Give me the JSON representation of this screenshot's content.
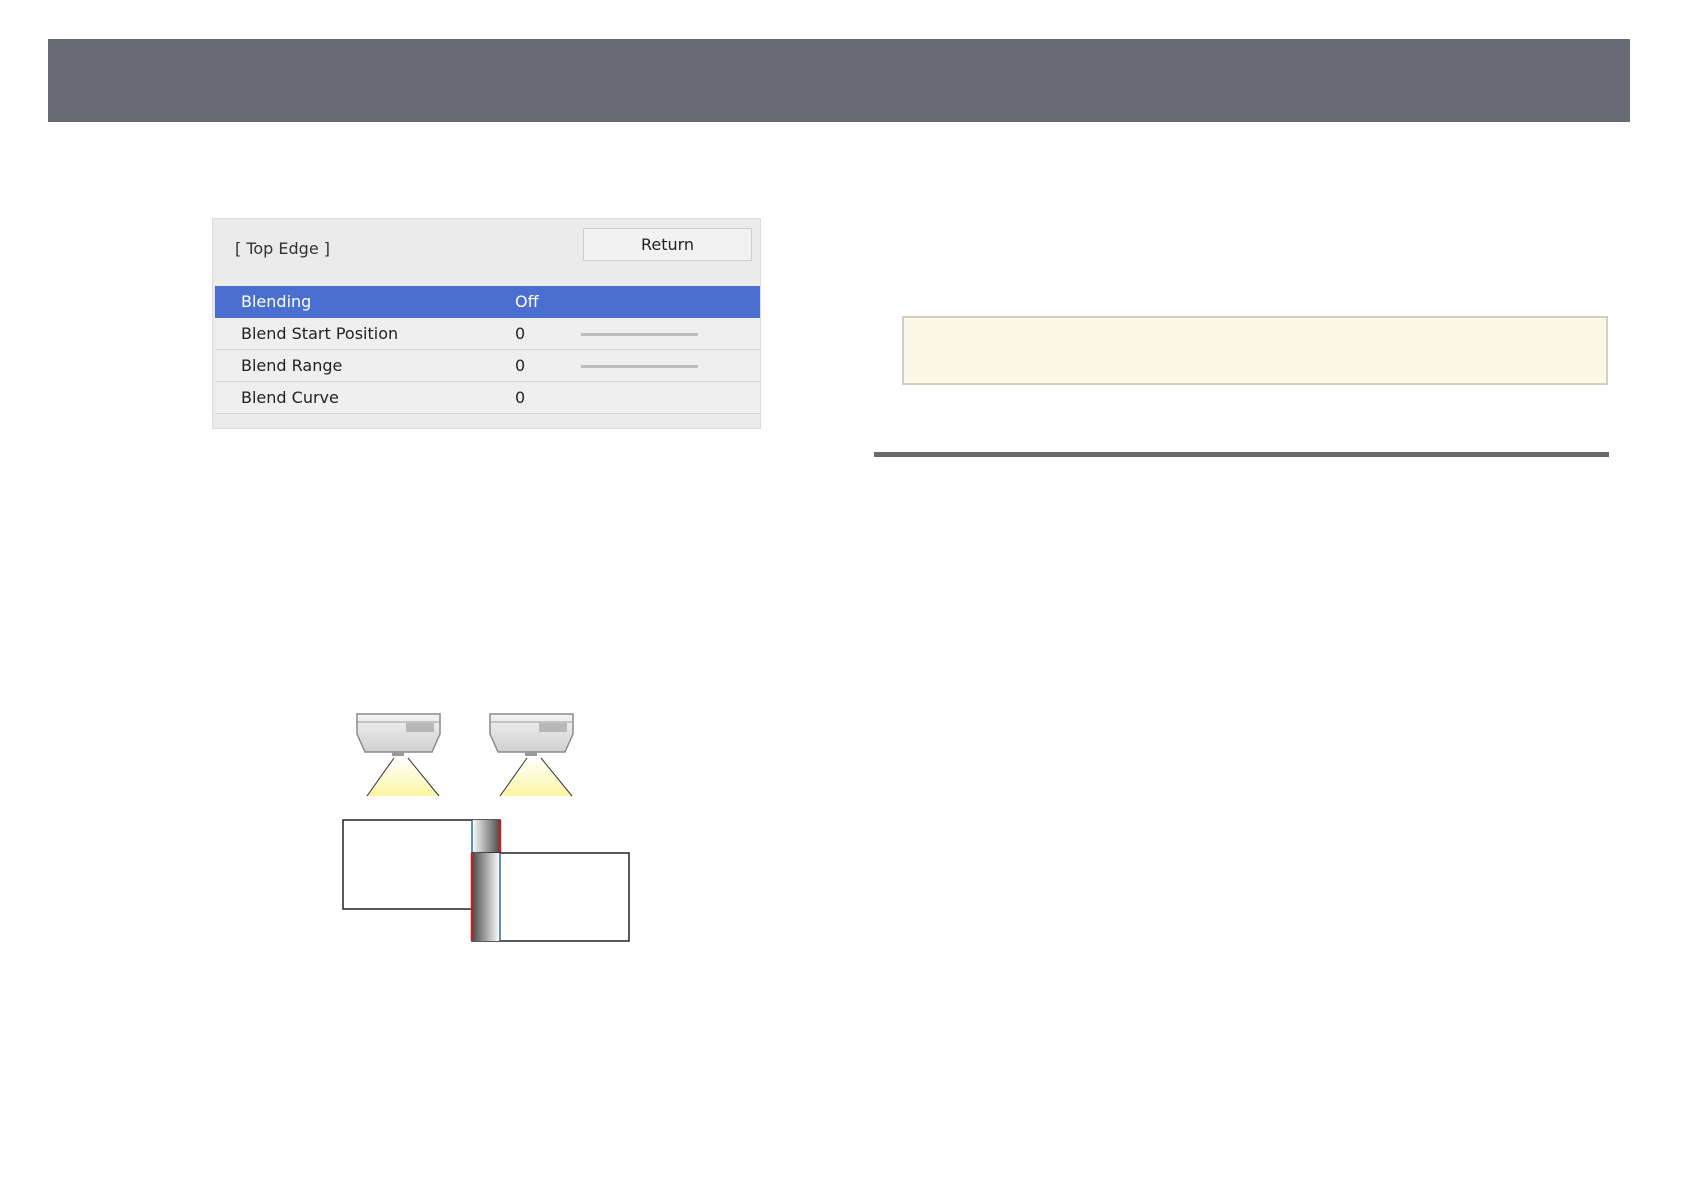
{
  "menu": {
    "title": "[ Top Edge ]",
    "return_label": "Return",
    "rows": [
      {
        "label": "Blending",
        "value": "Off",
        "selected": true,
        "slider": false
      },
      {
        "label": "Blend Start Position",
        "value": "0",
        "selected": false,
        "slider": true
      },
      {
        "label": "Blend Range",
        "value": "0",
        "selected": false,
        "slider": true
      },
      {
        "label": "Blend Curve",
        "value": "0",
        "selected": false,
        "slider": false
      }
    ]
  },
  "colors": {
    "banner": "#686b73",
    "selected_row": "#4a6fd0",
    "note_background": "#fdf8e6",
    "blend_edge_red": "#c0202a",
    "blend_edge_blue": "#1f6fa8",
    "light_beam": "#fdf6a3"
  },
  "illustration": {
    "icons": [
      "projector-icon",
      "projector-icon"
    ]
  }
}
